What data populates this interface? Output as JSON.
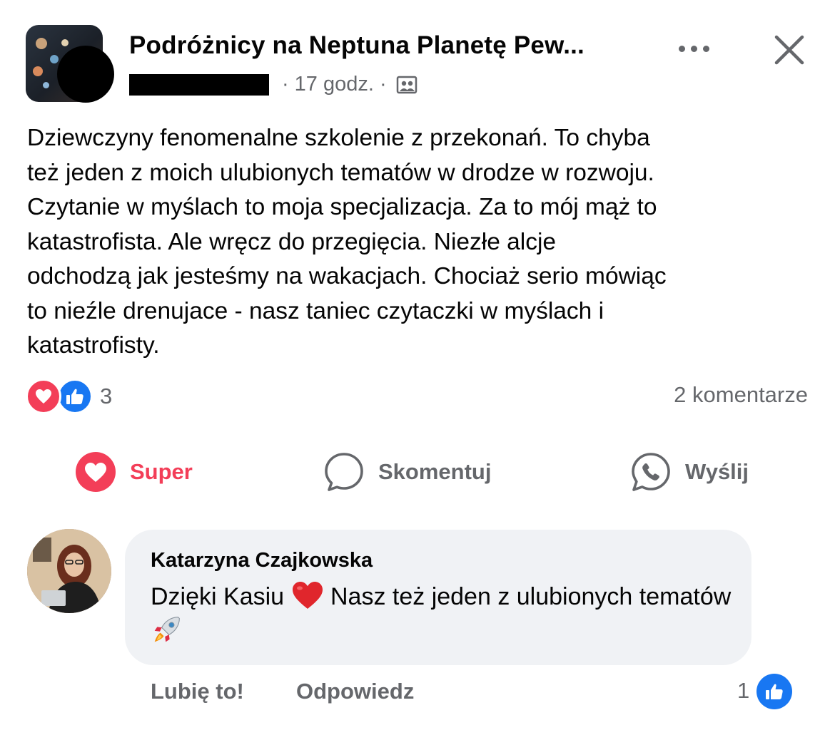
{
  "post": {
    "group_name": "Podróżnicy na Neptuna Planetę Pew...",
    "time": "17 godz.",
    "separator": "·",
    "text": "Dziewczyny fenomenalne szkolenie z przekonań. To chyba\nteż jeden z moich ulubionych tematów w drodze w rozwoju.\nCzytanie w myślach to moja specjalizacja. Za to mój mąż to\nkatastrofista. Ale wręcz do przegięcia. Niezłe alcje\nodchodzą jak jesteśmy na wakacjach. Chociaż serio mówiąc\nto nieźle drenujace - nasz taniec czytaczki w myślach i\nkatastrofisty.",
    "reactions": {
      "icons": [
        "love-icon",
        "like-icon"
      ],
      "count": "3"
    },
    "comments_count": "2 komentarze"
  },
  "actions": {
    "super_label": "Super",
    "comment_label": "Skomentuj",
    "send_label": "Wyślij"
  },
  "comment": {
    "author": "Katarzyna Czajkowska",
    "text_part1": "Dzięki Kasiu",
    "text_part2": " Nasz też jeden z ulubionych tematów",
    "emojis": [
      "red-heart",
      "rocket"
    ],
    "like_label": "Lubię to!",
    "reply_label": "Odpowiedz",
    "reaction_count": "1"
  },
  "colors": {
    "love": "#f33e58",
    "like": "#1877f2",
    "muted": "#65676b",
    "bubble": "#f0f2f5"
  }
}
